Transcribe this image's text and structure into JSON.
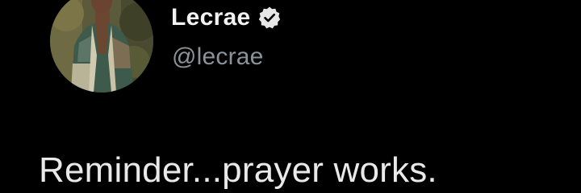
{
  "author": {
    "display_name": "Lecrae",
    "handle": "@lecrae",
    "verified": true,
    "verified_icon": "verified-badge-icon",
    "avatar_icon": "profile-photo"
  },
  "tweet": {
    "text": "Reminder...prayer works."
  },
  "colors": {
    "background": "#000000",
    "name": "#f2f2f2",
    "handle": "#8b9298",
    "text": "#e9e9e9",
    "badge": "#e6e6e6"
  }
}
